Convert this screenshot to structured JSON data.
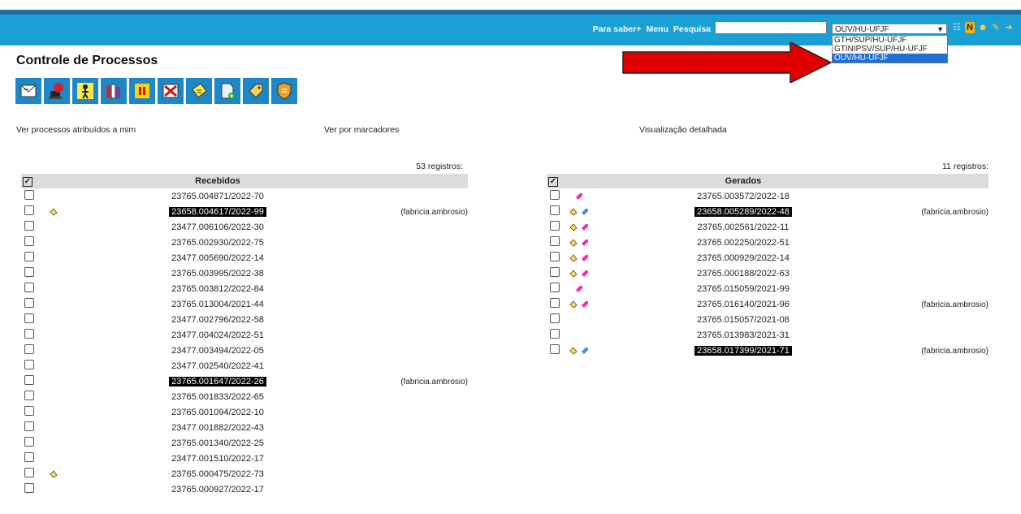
{
  "header": {
    "nav_help": "Para saber+",
    "nav_menu": "Menu",
    "nav_search": "Pesquisa",
    "search_value": "",
    "unit_selected": "OUV/HU-UFJF",
    "unit_options": [
      "GTH/SUP/HU-UFJF",
      "GTINIPSV/SUP/HU-UFJF",
      "OUV/HU-UFJF"
    ]
  },
  "page_title": "Controle de Processos",
  "links": {
    "assigned": "Ver processos atribuídos a mim",
    "markers": "Ver por marcadores",
    "detailed": "Visualização detalhada"
  },
  "received": {
    "count": "53 registros:",
    "header": "Recebidos",
    "rows": [
      {
        "num": "23765.004871/2022-70",
        "hl": false,
        "owner": "",
        "bell": false
      },
      {
        "num": "23658.004617/2022-99",
        "hl": true,
        "owner": "(fabricia.ambrosio)",
        "bell": true
      },
      {
        "num": "23477.006106/2022-30",
        "hl": false,
        "owner": "",
        "bell": false
      },
      {
        "num": "23765.002930/2022-75",
        "hl": false,
        "owner": "",
        "bell": false
      },
      {
        "num": "23477.005690/2022-14",
        "hl": false,
        "owner": "",
        "bell": false
      },
      {
        "num": "23765.003995/2022-38",
        "hl": false,
        "owner": "",
        "bell": false
      },
      {
        "num": "23765.003812/2022-84",
        "hl": false,
        "owner": "",
        "bell": false
      },
      {
        "num": "23765.013004/2021-44",
        "hl": false,
        "owner": "",
        "bell": false
      },
      {
        "num": "23477.002796/2022-58",
        "hl": false,
        "owner": "",
        "bell": false
      },
      {
        "num": "23477.004024/2022-51",
        "hl": false,
        "owner": "",
        "bell": false
      },
      {
        "num": "23477.003494/2022-05",
        "hl": false,
        "owner": "",
        "bell": false
      },
      {
        "num": "23477.002540/2022-41",
        "hl": false,
        "owner": "",
        "bell": false
      },
      {
        "num": "23765.001647/2022-26",
        "hl": true,
        "owner": "(fabricia.ambrosio)",
        "bell": false
      },
      {
        "num": "23765.001833/2022-65",
        "hl": false,
        "owner": "",
        "bell": false
      },
      {
        "num": "23765.001094/2022-10",
        "hl": false,
        "owner": "",
        "bell": false
      },
      {
        "num": "23477.001882/2022-43",
        "hl": false,
        "owner": "",
        "bell": false
      },
      {
        "num": "23765.001340/2022-25",
        "hl": false,
        "owner": "",
        "bell": false
      },
      {
        "num": "23477.001510/2022-17",
        "hl": false,
        "owner": "",
        "bell": false
      },
      {
        "num": "23765.000475/2022-73",
        "hl": false,
        "owner": "",
        "bell": true
      },
      {
        "num": "23765.000927/2022-17",
        "hl": false,
        "owner": "",
        "bell": false
      }
    ]
  },
  "generated": {
    "count": "11 registros:",
    "header": "Gerados",
    "rows": [
      {
        "num": "23765.003572/2022-18",
        "hl": false,
        "owner": "",
        "bell": false,
        "tag": "#ff2aa8"
      },
      {
        "num": "23658.005289/2022-48",
        "hl": true,
        "owner": "(fabricia.ambrosio)",
        "bell": true,
        "tag": "#3d8fe8"
      },
      {
        "num": "23765.002561/2022-11",
        "hl": false,
        "owner": "",
        "bell": true,
        "tag": "#ff2aa8"
      },
      {
        "num": "23765.002250/2022-51",
        "hl": false,
        "owner": "",
        "bell": true,
        "tag": "#ff2aa8"
      },
      {
        "num": "23765.000929/2022-14",
        "hl": false,
        "owner": "",
        "bell": true,
        "tag": "#ff2aa8"
      },
      {
        "num": "23765.000188/2022-63",
        "hl": false,
        "owner": "",
        "bell": true,
        "tag": "#ff2aa8"
      },
      {
        "num": "23765.015059/2021-99",
        "hl": false,
        "owner": "",
        "bell": false,
        "tag": "#ff2aa8"
      },
      {
        "num": "23765.016140/2021-96",
        "hl": false,
        "owner": "(fabricia.ambrosio)",
        "bell": true,
        "tag": "#ff2aa8"
      },
      {
        "num": "23765.015057/2021-08",
        "hl": false,
        "owner": "",
        "bell": false,
        "tag": ""
      },
      {
        "num": "23765.013983/2021-31",
        "hl": false,
        "owner": "",
        "bell": false,
        "tag": ""
      },
      {
        "num": "23658.017399/2021-71",
        "hl": true,
        "owner": "(fabricia.ambrosio)",
        "bell": true,
        "tag": "#3d8fe8"
      }
    ]
  },
  "colors": {
    "topbar": "#1aa0d4",
    "toolbar_button": "#1c88c8",
    "highlight": "#000000",
    "arrow": "#e00000"
  }
}
